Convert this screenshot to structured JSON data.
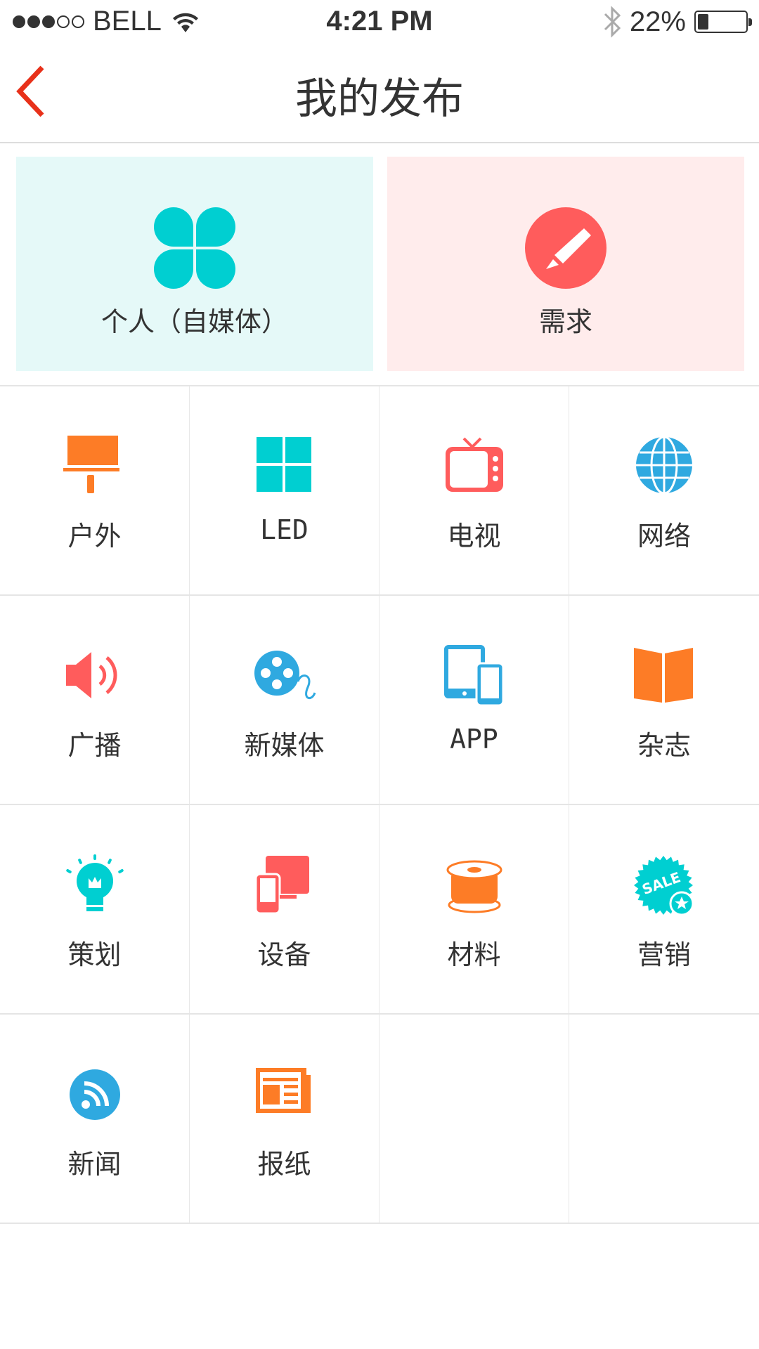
{
  "status": {
    "carrier": "BELL",
    "time": "4:21 PM",
    "battery": "22%",
    "battery_level": 0.22,
    "signal_bars": 3
  },
  "header": {
    "title": "我的发布"
  },
  "cards": [
    {
      "label": "个人（自媒体）",
      "icon": "clover-icon",
      "bg": "#e5f9f8",
      "color": "#00cfd1"
    },
    {
      "label": "需求",
      "icon": "pencil-circle-icon",
      "bg": "#ffecec",
      "color": "#ff5c5c"
    }
  ],
  "categories": [
    {
      "label": "户外",
      "icon": "billboard-icon",
      "color": "#fd7c26"
    },
    {
      "label": "LED",
      "icon": "led-grid-icon",
      "color": "#00cfd1"
    },
    {
      "label": "电视",
      "icon": "tv-icon",
      "color": "#ff5c5c"
    },
    {
      "label": "网络",
      "icon": "globe-icon",
      "color": "#2fa9e0"
    },
    {
      "label": "广播",
      "icon": "speaker-icon",
      "color": "#ff5c5c"
    },
    {
      "label": "新媒体",
      "icon": "film-reel-icon",
      "color": "#2fa9e0"
    },
    {
      "label": "APP",
      "icon": "devices-icon",
      "color": "#2fa9e0"
    },
    {
      "label": "杂志",
      "icon": "magazine-icon",
      "color": "#fd7c26"
    },
    {
      "label": "策划",
      "icon": "lightbulb-icon",
      "color": "#00cfd1"
    },
    {
      "label": "设备",
      "icon": "equipment-icon",
      "color": "#ff5c5c"
    },
    {
      "label": "材料",
      "icon": "spool-icon",
      "color": "#fd7c26"
    },
    {
      "label": "营销",
      "icon": "sale-badge-icon",
      "color": "#00cfd1"
    },
    {
      "label": "新闻",
      "icon": "rss-icon",
      "color": "#2fa9e0"
    },
    {
      "label": "报纸",
      "icon": "newspaper-icon",
      "color": "#fd7c26"
    }
  ],
  "accent": "#e8311a"
}
